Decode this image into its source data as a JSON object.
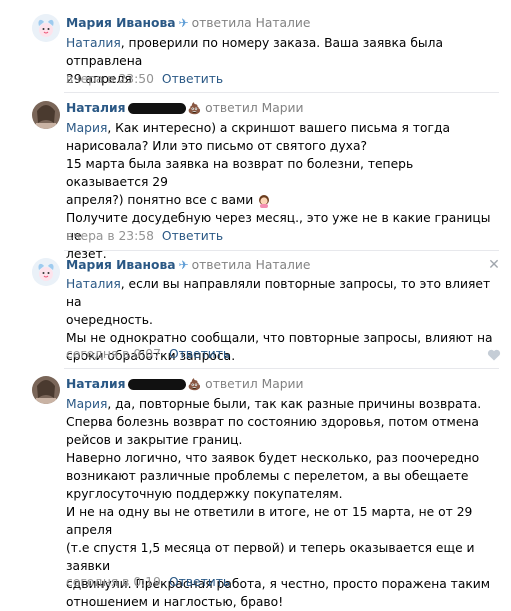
{
  "comments": [
    {
      "author": "Мария Иванова",
      "reply_label": "ответила",
      "reply_to": "Наталие",
      "mention": "Наталия",
      "text": ", проверили по номеру заказа. Ваша заявка была отправлена\n29 апреля",
      "time": "вчера в 23:50",
      "reply_button": "Ответить"
    },
    {
      "author": "Наталия",
      "reply_label": "ответил",
      "reply_to": "Марии",
      "mention": "Мария",
      "text": ", Как интересно) а скриншот вашего письма я тогда\nнарисовала? Или это письмо от святого духа?\n15 марта была заявка на возврат по болезни, теперь оказывается 29\nапреля?) понятно все с вами",
      "text2": "Получите досудебную через месяц., это уже не в какие границы не\nлезет.",
      "time": "вчера в 23:58",
      "reply_button": "Ответить"
    },
    {
      "author": "Мария Иванова",
      "reply_label": "ответила",
      "reply_to": "Наталие",
      "mention": "Наталия",
      "text": ", если вы направляли повторные запросы, то это влияет на\nочередность.\nМы не однократно сообщали, что повторные запросы, влияют на\nсроки обработки запроса.",
      "time": "сегодня в 0:07",
      "reply_button": "Ответить"
    },
    {
      "author": "Наталия",
      "reply_label": "ответил",
      "reply_to": "Марии",
      "mention": "Мария",
      "text": ", да, повторные были, так как разные причины возврата.\nСперва болезнь возврат по состоянию здоровья, потом отмена\nрейсов и закрытие границ.\nНаверно логично, что заявок будет несколько, раз поочередно\nвозникают различные проблемы с перелетом, а вы обещаете\nкруглосуточную поддержку покупателям.\nИ не на одну вы не ответили в итоге, не от 15 марта, не от 29 апреля\n(т.е спустя 1,5 месяца от первой) и теперь оказывается еще и заявки\nсдвинули. Прекрасная работа, я честно, просто поражена таким\nотношением и наглостью, браво!",
      "time": "сегодня в 0:19",
      "reply_button": "Ответить"
    }
  ],
  "icons": {
    "plane": "paper-plane-icon",
    "poop": "poop-emoji-icon",
    "close": "close-icon",
    "like": "heart-icon",
    "emoji": "woman-tipping-hand-emoji"
  },
  "colors": {
    "link": "#2a5885",
    "meta": "#939393",
    "divider": "#e7e8ec"
  }
}
